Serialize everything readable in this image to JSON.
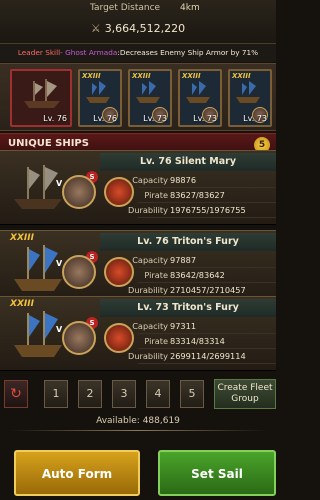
{
  "header": {
    "target_distance_label": "Target Distance",
    "target_distance_value": "4km",
    "power": "3,664,512,220"
  },
  "leader_skill": {
    "label": "Leader Skill",
    "name": "- Ghost Armada",
    "description": ":Decreases Enemy Ship Armor by 71%"
  },
  "fleet_slots": [
    {
      "tier": "",
      "level": "Lv. 76"
    },
    {
      "tier": "XXIII",
      "level": "Lv. 76"
    },
    {
      "tier": "XXIII",
      "level": "Lv. 73"
    },
    {
      "tier": "XXIII",
      "level": "Lv. 73"
    },
    {
      "tier": "XXIII",
      "level": "Lv. 73"
    }
  ],
  "unique_ships": {
    "title": "UNIQUE SHIPS",
    "count": "5"
  },
  "ship_cards": [
    {
      "tier": "",
      "name": "Lv. 76 Silent Mary",
      "stats": [
        {
          "label": "Capacity",
          "value": "98876"
        },
        {
          "label": "Pirate",
          "value": "83627/83627"
        },
        {
          "label": "Durability",
          "value": "1976755/1976755"
        }
      ]
    },
    {
      "tier": "XXIII",
      "name": "Lv. 76 Triton's Fury",
      "stats": [
        {
          "label": "Capacity",
          "value": "97887"
        },
        {
          "label": "Pirate",
          "value": "83642/83642"
        },
        {
          "label": "Durability",
          "value": "2710457/2710457"
        }
      ]
    },
    {
      "tier": "XXIII",
      "name": "Lv. 73 Triton's Fury",
      "stats": [
        {
          "label": "Capacity",
          "value": "97311"
        },
        {
          "label": "Pirate",
          "value": "83314/83314"
        },
        {
          "label": "Durability",
          "value": "2699114/2699114"
        }
      ]
    }
  ],
  "fleet_nav": {
    "reset_icon": "↻",
    "numbers": [
      "1",
      "2",
      "3",
      "4",
      "5"
    ],
    "create_label": "Create Fleet Group"
  },
  "available": "Available: 488,619",
  "buttons": {
    "auto_form": "Auto Form",
    "set_sail": "Set Sail"
  },
  "colors": {
    "skill_label": "#ff6a6a",
    "skill_name": "#c85bd6",
    "auto_form_button": "#d6a21c",
    "set_sail_button": "#4aa42a"
  }
}
